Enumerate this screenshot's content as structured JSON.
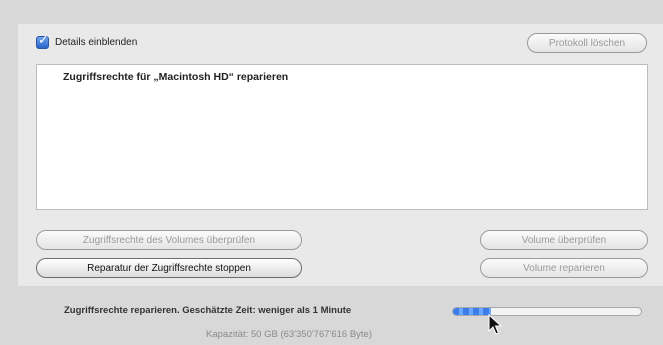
{
  "details": {
    "label": "Details einblenden",
    "checked": true
  },
  "log_clear_label": "Protokoll löschen",
  "log": {
    "lines": [
      "Zugriffsrechte für „Macintosh HD“ reparieren"
    ]
  },
  "buttons": {
    "verify_permissions": "Zugriffsrechte des Volumes überprüfen",
    "stop_repair_permissions": "Reparatur der Zugriffsrechte stoppen",
    "verify_volume": "Volume überprüfen",
    "repair_volume": "Volume reparieren"
  },
  "status": {
    "text": "Zugriffsrechte reparieren. Geschätzte Zeit: weniger als 1 Minute",
    "progress_fraction": 0.2
  },
  "capacity_text": "Kapazität: 50 GB (63'350'767'616 Byte)",
  "colors": {
    "accent": "#3c7ee8",
    "disabled_text": "#9a9a9a"
  },
  "icons": {
    "cursor": "mouse-pointer-icon",
    "checkbox": "checkmark-icon"
  }
}
